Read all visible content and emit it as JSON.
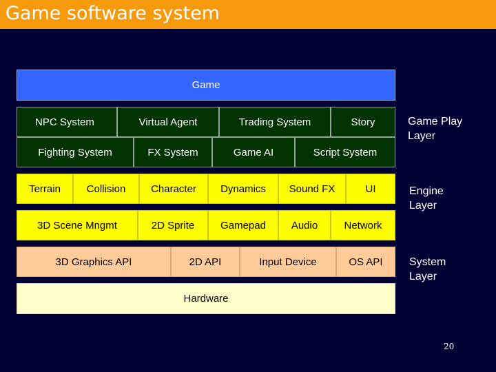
{
  "title": "Game software system",
  "page_number": "20",
  "layers": {
    "game_play": "Game Play Layer",
    "engine": "Engine Layer",
    "system": "System Layer"
  },
  "blocks": {
    "game": "Game",
    "npc_system": "NPC System",
    "virtual_agent": "Virtual Agent",
    "trading_system": "Trading System",
    "story": "Story",
    "fighting_system": "Fighting System",
    "fx_system": "FX System",
    "game_ai": "Game AI",
    "script_system": "Script System",
    "terrain": "Terrain",
    "collision": "Collision",
    "character": "Character",
    "dynamics": "Dynamics",
    "sound_fx": "Sound FX",
    "ui": "UI",
    "scene_mngmt": "3D Scene Mngmt",
    "sprite_2d": "2D Sprite",
    "gamepad": "Gamepad",
    "audio": "Audio",
    "network": "Network",
    "graphics_api_3d": "3D Graphics API",
    "api_2d": "2D API",
    "input_device": "Input Device",
    "os_api": "OS API",
    "hardware": "Hardware"
  },
  "colors": {
    "title_bar": "#F59A0D",
    "background": "#000033",
    "game_block": "#3366FF",
    "game_play_blocks": "#003300",
    "engine_blocks": "#FFFF00",
    "system_blocks": "#FFCC99",
    "hardware_block": "#FFFFCC"
  }
}
